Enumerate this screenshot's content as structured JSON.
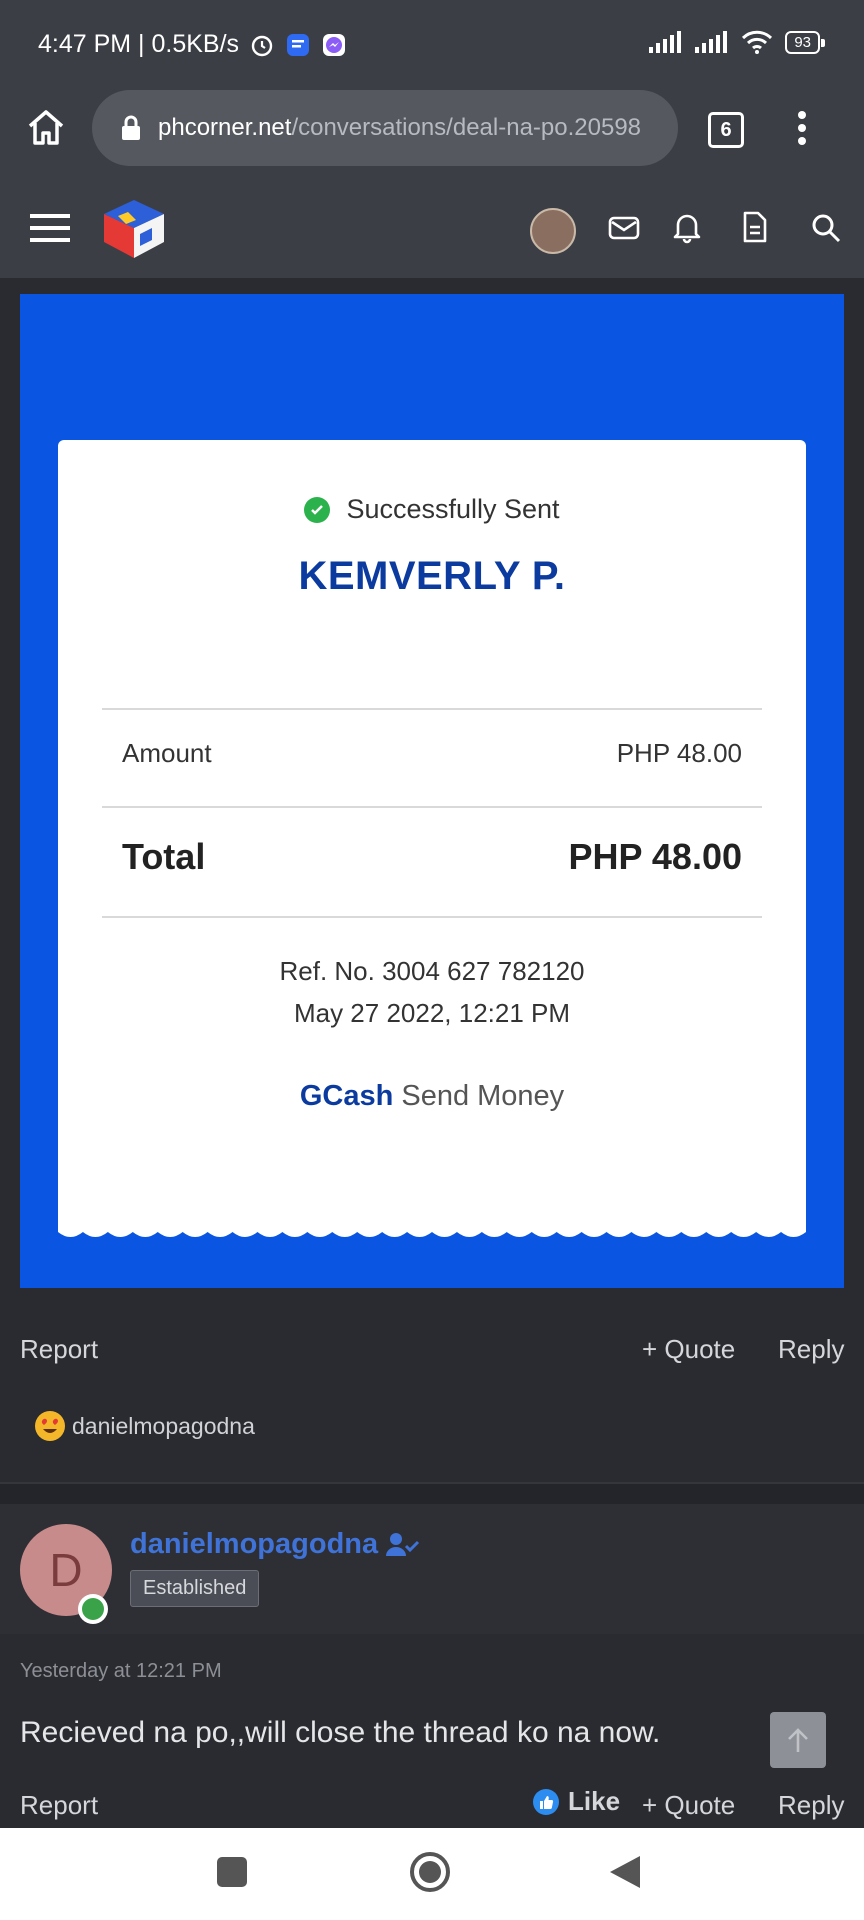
{
  "status": {
    "time_speed": "4:47 PM | 0.5KB/s",
    "battery": "93"
  },
  "browser": {
    "url_domain": "phcorner.net",
    "url_path": "/conversations/deal-na-po.20598",
    "tab_count": "6"
  },
  "receipt": {
    "status_text": "Successfully Sent",
    "recipient": "KEMVERLY P.",
    "amount_label": "Amount",
    "amount_value": "PHP 48.00",
    "total_label": "Total",
    "total_value": "PHP 48.00",
    "ref_no": "Ref. No. 3004 627 782120",
    "datetime": "May 27 2022, 12:21 PM",
    "brand": "GCash",
    "service": "Send Money"
  },
  "post1": {
    "report": "Report",
    "quote": "+ Quote",
    "reply": "Reply",
    "reaction_user": "danielmopagodna"
  },
  "post2": {
    "avatar_letter": "D",
    "username": "danielmopagodna",
    "badge": "Established",
    "time": "Yesterday at 12:21 PM",
    "message": "Recieved na po,,will close the thread ko na now.",
    "report": "Report",
    "like": "Like",
    "quote": "+ Quote",
    "reply": "Reply"
  },
  "colors": {
    "receipt_bg": "#0a56e3",
    "brand_blue": "#0c3ba0",
    "username_blue": "#3f73d8",
    "success_green": "#2bb24c"
  }
}
